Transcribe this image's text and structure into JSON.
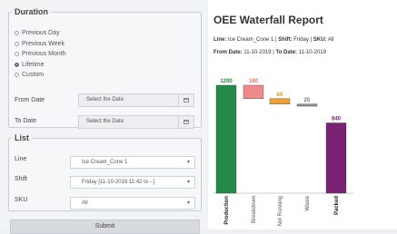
{
  "duration": {
    "legend": "Duration",
    "options": [
      {
        "label": "Previous Day",
        "checked": false
      },
      {
        "label": "Previous Week",
        "checked": false
      },
      {
        "label": "Previous Month",
        "checked": false
      },
      {
        "label": "Lifetime",
        "checked": true
      },
      {
        "label": "Custom",
        "checked": false
      }
    ],
    "from_label": "From Date",
    "from_value": "Select the Date",
    "to_label": "To Date",
    "to_value": "Select the Date"
  },
  "list": {
    "legend": "List",
    "line_label": "Line",
    "line_value": "Ice Cream_Cone 1",
    "shift_label": "Shift",
    "shift_value": "Friday [11-10-2019 11:42 to - ]",
    "sku_label": "SKU",
    "sku_value": "All"
  },
  "submit_label": "Submit",
  "report": {
    "title": "OEE Waterfall Report",
    "line_key": "Line:",
    "line_val": "Ice Cream_Cone 1",
    "shift_key": "Shift:",
    "shift_val": "Friday",
    "sku_key": "SKU:",
    "sku_val": "All",
    "from_key": "From Date:",
    "from_val": "11-10-2019",
    "to_key": "To Date:",
    "to_val": "11-10-2019"
  },
  "chart_data": {
    "type": "bar",
    "categories": [
      "Production",
      "Breakdown",
      "Not Running",
      "Waste",
      "Packed"
    ],
    "values": [
      1290,
      160,
      65,
      25,
      840
    ],
    "value_labels": [
      "1290",
      "160",
      "65",
      "25",
      "840"
    ],
    "colors": [
      "#238a48",
      "#ef8a8a",
      "#f0a030",
      "#8a8f94",
      "#7a2272"
    ],
    "label_colors": [
      "#238a48",
      "#e66b6b",
      "#e09020",
      "#777777",
      "#7a2272"
    ]
  }
}
